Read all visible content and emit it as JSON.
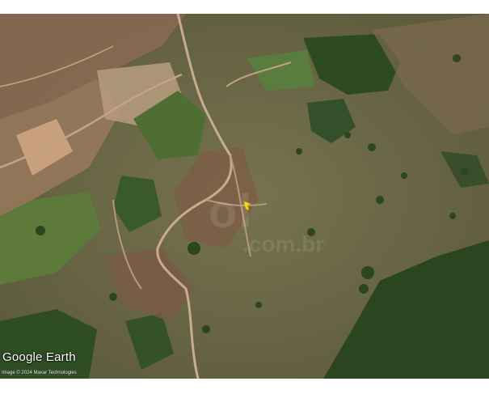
{
  "map": {
    "brand_label": "Google Earth",
    "imagery_credit": "Image © 2024 Maxar Technologies",
    "watermark_text": "ol",
    "watermark_subtext": ".com.br",
    "colors": {
      "pasture": "#6b6a48",
      "forest": "#2f4a22",
      "dirt_road": "#c4a78c",
      "bare_soil": "#b08a6e",
      "marker": "#f5e214"
    },
    "marker_icon": "location-pin-icon"
  }
}
